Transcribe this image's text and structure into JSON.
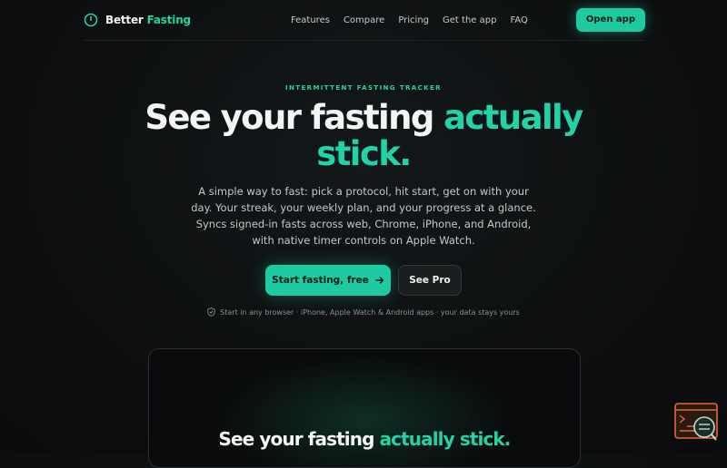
{
  "brand": {
    "name_part1": "Better",
    "name_part2": "Fasting",
    "icon": "timer-icon"
  },
  "nav": {
    "links": [
      "Features",
      "Compare",
      "Pricing",
      "Get the app",
      "FAQ"
    ],
    "cta": "Open app"
  },
  "hero": {
    "eyebrow": "INTERMITTENT FASTING TRACKER",
    "headline_plain": "See your fasting",
    "headline_accent_1": "actually",
    "headline_accent_2": "stick.",
    "subtitle": "A simple way to fast: pick a protocol, hit start, get on with your day. Your streak, your weekly plan, and your progress at a glance. Syncs signed-in fasts across web, Chrome, iPhone, and Android, with native timer controls on Apple Watch.",
    "primary_cta": "Start fasting, free",
    "secondary_cta": "See Pro",
    "trust_note": "Start in any browser · iPhone, Apple Watch & Android apps · your data stays yours"
  },
  "preview": {
    "title_plain": "See your fasting",
    "title_accent": "actually stick."
  },
  "colors": {
    "accent": "#22d3a6",
    "background": "#0d0f10",
    "widget": "#e0693a"
  }
}
